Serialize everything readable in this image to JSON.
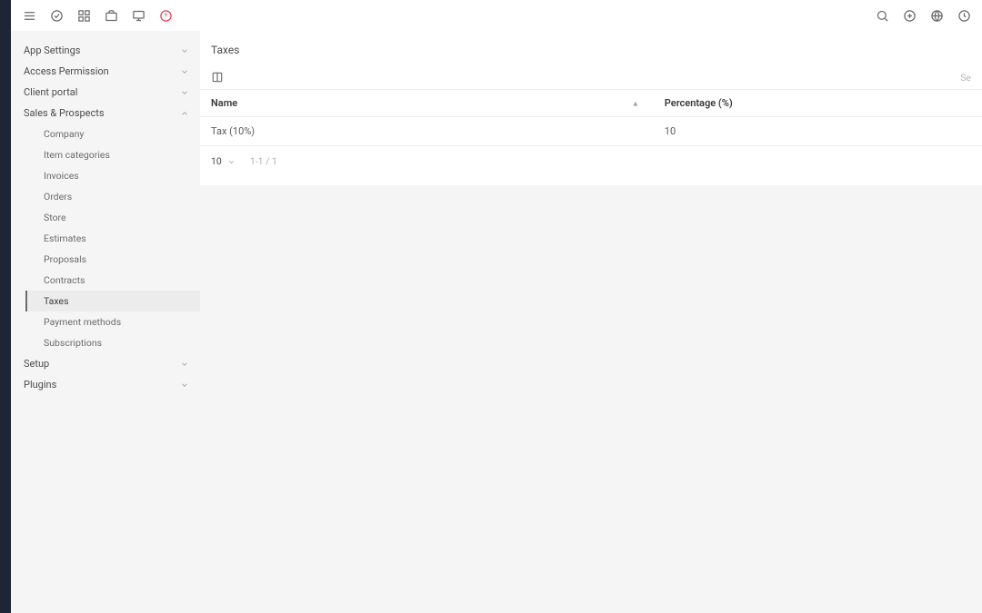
{
  "sidebar": {
    "groups": [
      {
        "label": "App Settings",
        "expanded": false
      },
      {
        "label": "Access Permission",
        "expanded": false
      },
      {
        "label": "Client portal",
        "expanded": false
      },
      {
        "label": "Sales & Prospects",
        "expanded": true
      },
      {
        "label": "Setup",
        "expanded": false
      },
      {
        "label": "Plugins",
        "expanded": false
      }
    ],
    "sales_prospects_items": [
      "Company",
      "Item categories",
      "Invoices",
      "Orders",
      "Store",
      "Estimates",
      "Proposals",
      "Contracts",
      "Taxes",
      "Payment methods",
      "Subscriptions"
    ],
    "active_item": "Taxes"
  },
  "page": {
    "title": "Taxes",
    "search_placeholder": "Se"
  },
  "table": {
    "columns": {
      "name": "Name",
      "percentage": "Percentage (%)"
    },
    "rows": [
      {
        "name": "Tax (10%)",
        "percentage": "10"
      }
    ],
    "footer": {
      "page_size": "10",
      "range": "1-1 / 1"
    }
  }
}
